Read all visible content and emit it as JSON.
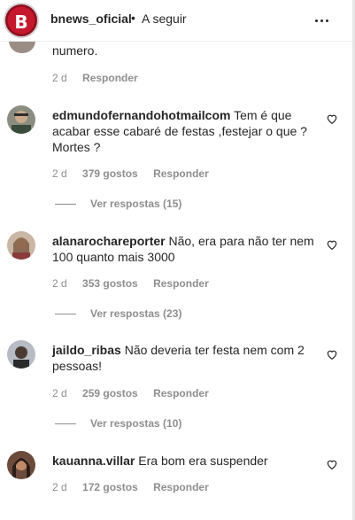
{
  "header": {
    "account": "bnews_oficial",
    "separator": "•",
    "follow": "A seguir",
    "logo_letter": "B"
  },
  "comments": [
    {
      "username": "",
      "text": "numero.",
      "time": "2 d",
      "likes": "",
      "reply": "Responder"
    },
    {
      "username": "edmundofernandohotmailcom",
      "text_line1": "Tem é que",
      "text_line2": "acabar esse cabaré de festas ,festejar o que ?",
      "text_line3": "Mortes ?",
      "time": "2 d",
      "likes": "379 gostos",
      "reply": "Responder",
      "view_replies": "Ver respostas (15)"
    },
    {
      "username": "alanarochareporter",
      "text_line1": "Não, era para não ter nem",
      "text_line2": "100 quanto mais 3000",
      "time": "2 d",
      "likes": "353 gostos",
      "reply": "Responder",
      "view_replies": "Ver respostas (23)"
    },
    {
      "username": "jaildo_ribas",
      "text_line1": "Não deveria ter festa nem com 2",
      "text_line2": "pessoas!",
      "time": "2 d",
      "likes": "259 gostos",
      "reply": "Responder",
      "view_replies": "Ver respostas (10)"
    },
    {
      "username": "kauanna.villar",
      "text_line1": "Era bom era suspender",
      "time": "2 d",
      "likes": "172 gostos",
      "reply": "Responder"
    }
  ]
}
